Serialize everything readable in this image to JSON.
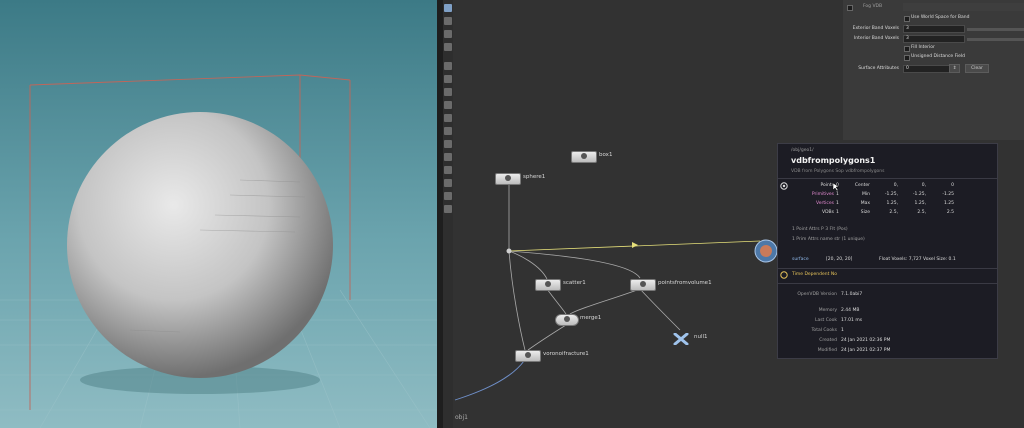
{
  "params": {
    "fog_vdb_label": "Fog VDB",
    "use_world_space_label": "Use World Space for Band",
    "exterior_band_label": "Exterior Band Voxels",
    "exterior_band_value": "3",
    "interior_band_label": "Interior Band Voxels",
    "interior_band_value": "3",
    "fill_interior_label": "Fill Interior",
    "unsigned_distance_label": "Unsigned Distance Field",
    "surface_attributes_label": "Surface Attributes",
    "surface_attributes_value": "0",
    "clear_label": "Clear"
  },
  "nodes": [
    {
      "label": "box1"
    },
    {
      "label": "sphere1"
    },
    {
      "label": "scatter1"
    },
    {
      "label": "pointsfromvolume1"
    },
    {
      "label": "merge1"
    },
    {
      "label": "null1"
    },
    {
      "label": "voronoifracture1"
    }
  ],
  "network_path": "obj1",
  "info": {
    "path": "/obj/geo1/",
    "title": "vdbfrompolygons1",
    "subtitle": "VDB from Polygons Sop vdbfrompolygons",
    "points_label": "Points",
    "points_value": "0",
    "primitives_label": "Primitives",
    "primitives_value": "1",
    "vertices_label": "Vertices",
    "vertices_value": "1",
    "vdbs_label": "VDBs",
    "vdbs_value": "1",
    "center_label": "Center",
    "center_values": [
      "0,",
      "0,",
      "0"
    ],
    "min_label": "Min",
    "min_values": [
      "-1.25,",
      "-1.25,",
      "-1.25"
    ],
    "max_label": "Max",
    "max_values": [
      "1.25,",
      "1.25,",
      "1.25"
    ],
    "size_label": "Size",
    "size_values": [
      "2.5,",
      "2.5,",
      "2.5"
    ],
    "point_attrs": "1 Point Attrs   P 3 Flt (Pos)",
    "prim_attrs": "1 Prim Attrs   name str (1 unique)",
    "surface_label": "surface",
    "surface_dims": "[20, 20, 20]",
    "surface_voxels": "Float Voxels: 7,727 Voxel Size: 0.1",
    "time_dependent": "Time Dependent  No",
    "openvdb_label": "OpenVDB Version",
    "openvdb_value": "7.1.0abi7",
    "memory_label": "Memory",
    "memory_value": "2.44 MB",
    "last_cook_label": "Last Cook",
    "last_cook_value": "17.01 ms",
    "total_cooks_label": "Total Cooks",
    "total_cooks_value": "1",
    "created_label": "Created",
    "created_value": "24 Jan 2021 02:36 PM",
    "modified_label": "Modified",
    "modified_value": "24 Jan 2021 02:37 PM"
  },
  "colors": {
    "viewport_bg": "#5f9ca6",
    "sphere": "#c7c7c7",
    "network_bg": "#323232",
    "info_bg": "#1c1c24",
    "vdb_wire": "#e6e07a"
  }
}
